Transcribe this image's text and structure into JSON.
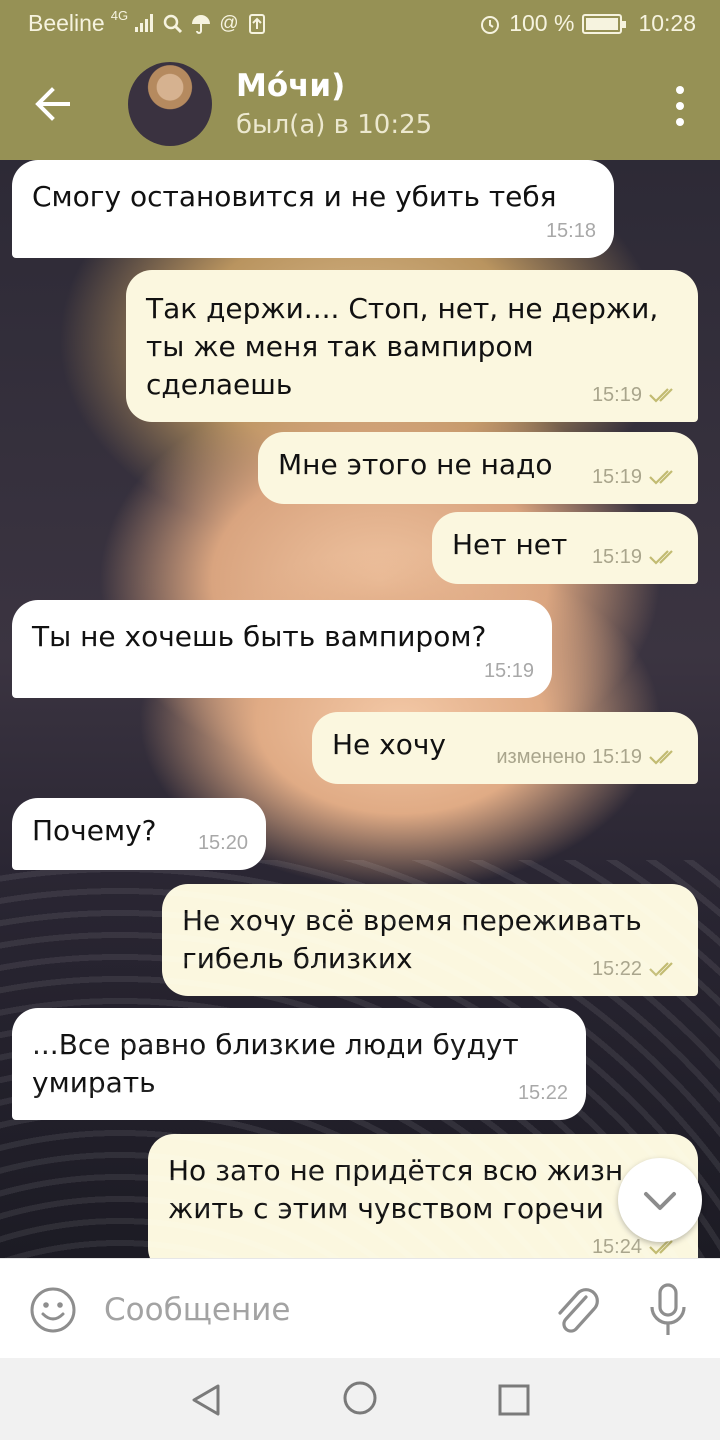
{
  "status_bar": {
    "carrier": "Beeline",
    "network": "4G",
    "battery": "100 %",
    "time": "10:28"
  },
  "header": {
    "contact_name": "Мо́чи)",
    "last_seen": "был(а) в 10:25"
  },
  "messages": [
    {
      "direction": "in",
      "text": "Смогу остановится и не убить тебя",
      "time": "15:18"
    },
    {
      "direction": "out",
      "text": "Так держи.... Стоп, нет, не держи,\nты же меня так вампиром\nсделаешь",
      "time": "15:19",
      "read": true
    },
    {
      "direction": "out",
      "text": "Мне этого не надо",
      "time": "15:19",
      "read": true
    },
    {
      "direction": "out",
      "text": "Нет нет",
      "time": "15:19",
      "read": true
    },
    {
      "direction": "in",
      "text": "Ты не хочешь быть вампиром?",
      "time": "15:19"
    },
    {
      "direction": "out",
      "text": "Не хочу",
      "edited_label": "изменено",
      "time": "15:19",
      "read": true
    },
    {
      "direction": "in",
      "text": "Почему?",
      "time": "15:20"
    },
    {
      "direction": "out",
      "text": "Не хочу всё время переживать\nгибель близких",
      "time": "15:22",
      "read": true
    },
    {
      "direction": "in",
      "text": "...Все равно близкие люди будут\nумирать",
      "time": "15:22"
    },
    {
      "direction": "out",
      "text": "Но зато не придётся всю жизн\nжить с этим чувством горечи",
      "time": "15:24",
      "read": true
    }
  ],
  "input": {
    "placeholder": "Сообщение"
  },
  "icons": {
    "back": "arrow-left-icon",
    "menu": "more-vertical-icon",
    "emoji": "smiley-icon",
    "attach": "paperclip-icon",
    "mic": "microphone-icon",
    "scroll": "chevron-down-icon"
  },
  "colors": {
    "header": "#969155",
    "incoming_bubble": "#ffffff",
    "outgoing_bubble": "#fbf7df",
    "read_check": "#c2bb72"
  }
}
